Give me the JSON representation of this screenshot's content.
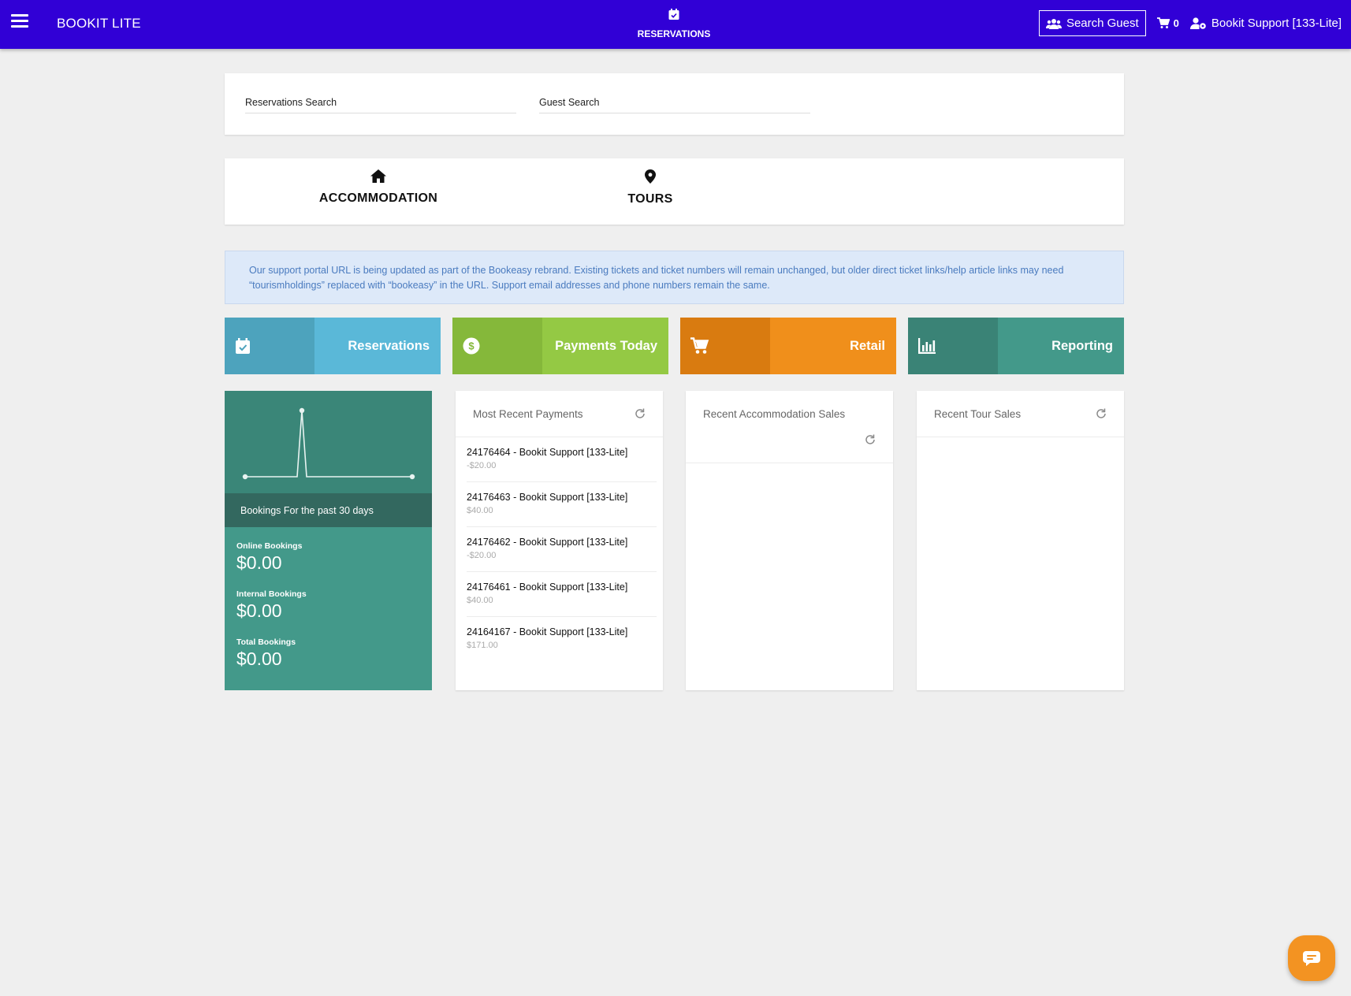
{
  "header": {
    "brand": "BOOKIT LITE",
    "nav_label": "RESERVATIONS",
    "search_guest_label": "Search Guest",
    "cart_count": "0",
    "user_label": "Bookit Support [133-Lite]"
  },
  "search": {
    "reservations_label": "Reservations Search",
    "guest_label": "Guest Search"
  },
  "categories": [
    {
      "label": "ACCOMMODATION",
      "icon": "home-icon"
    },
    {
      "label": "TOURS",
      "icon": "map-pin-icon"
    }
  ],
  "notice": "Our support portal URL is being updated as part of the Bookeasy rebrand. Existing tickets and ticket numbers will remain unchanged, but older direct ticket links/help article links may need “tourismholdings” replaced with “bookeasy” in the URL. Support email addresses and phone numbers remain the same.",
  "tiles": [
    {
      "label": "Reservations",
      "icon": "calendar-check-icon",
      "color_dark": "#4da3bd",
      "color_light": "#5ab8d8"
    },
    {
      "label": "Payments Today",
      "icon": "dollar-circle-icon",
      "color_dark": "#85b83a",
      "color_light": "#94c944"
    },
    {
      "label": "Retail",
      "icon": "cart-icon",
      "color_dark": "#d97b10",
      "color_light": "#f08f1b"
    },
    {
      "label": "Reporting",
      "icon": "bar-chart-icon",
      "color_dark": "#3a8376",
      "color_light": "#43998a"
    }
  ],
  "bookings": {
    "caption": "Bookings For the past 30 days",
    "online_label": "Online Bookings",
    "online_value": "$0.00",
    "internal_label": "Internal Bookings",
    "internal_value": "$0.00",
    "total_label": "Total Bookings",
    "total_value": "$0.00"
  },
  "recent_payments": {
    "title": "Most Recent Payments",
    "items": [
      {
        "ref": "24176464 - Bookit Support [133-Lite]",
        "amount": "-$20.00"
      },
      {
        "ref": "24176463 - Bookit Support [133-Lite]",
        "amount": "$40.00"
      },
      {
        "ref": "24176462 - Bookit Support [133-Lite]",
        "amount": "-$20.00"
      },
      {
        "ref": "24176461 - Bookit Support [133-Lite]",
        "amount": "$40.00"
      },
      {
        "ref": "24164167 - Bookit Support [133-Lite]",
        "amount": "$171.00"
      }
    ]
  },
  "recent_accommodation": {
    "title": "Recent Accommodation Sales"
  },
  "recent_tours": {
    "title": "Recent Tour Sales"
  }
}
